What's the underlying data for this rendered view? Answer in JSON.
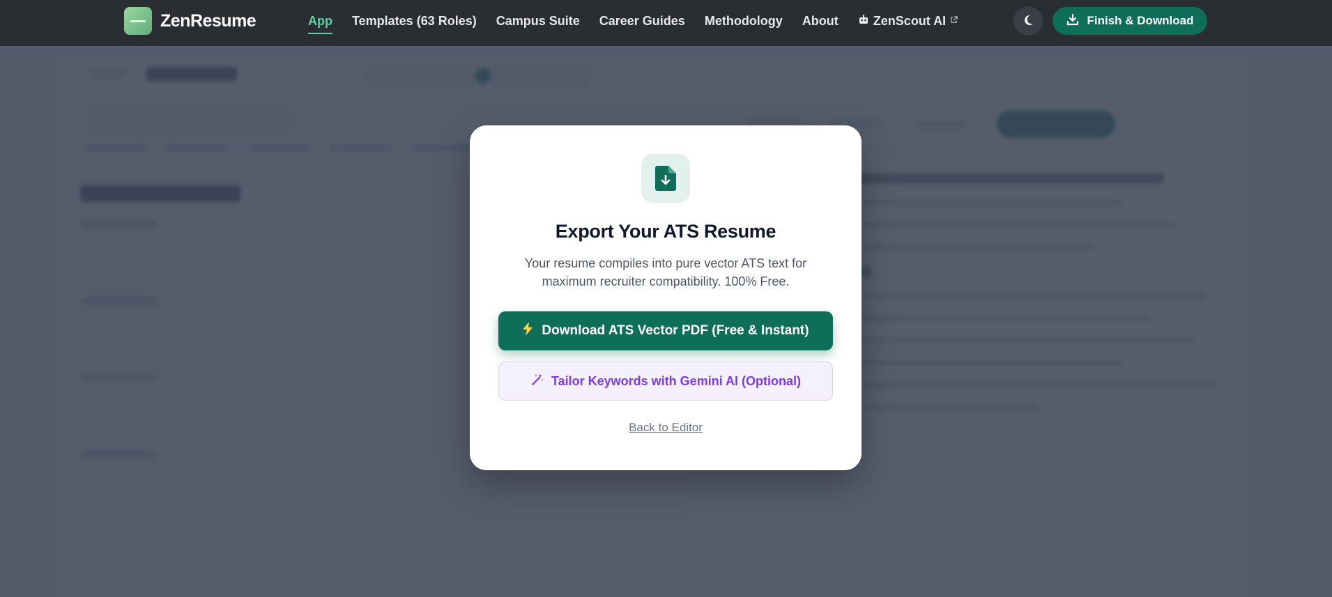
{
  "brand": {
    "name": "ZenResume",
    "logo_icon": "zenresume-logo-icon"
  },
  "nav": {
    "items": [
      {
        "label": "App",
        "active": true
      },
      {
        "label": "Templates (63 Roles)"
      },
      {
        "label": "Campus Suite"
      },
      {
        "label": "Career Guides"
      },
      {
        "label": "Methodology"
      },
      {
        "label": "About"
      },
      {
        "label": "ZenScout AI",
        "icon": "robot-icon",
        "external": true
      }
    ],
    "theme_toggle_icon": "moon-icon",
    "finish_button": {
      "label": "Finish & Download",
      "icon": "download-icon"
    }
  },
  "modal": {
    "icon": "file-download-icon",
    "title": "Export Your ATS Resume",
    "description": "Your resume compiles into pure vector ATS text for maximum recruiter compatibility. 100% Free.",
    "primary_button": {
      "label": "Download ATS Vector PDF (Free & Instant)",
      "icon": "lightning-icon"
    },
    "secondary_button": {
      "label": "Tailor Keywords with Gemini AI (Optional)",
      "icon": "magic-wand-icon"
    },
    "back_link": "Back to Editor"
  },
  "colors": {
    "topbar_bg": "#2a2e33",
    "accent_green": "#0f6e5a",
    "active_nav": "#5fd3a4",
    "ai_purple": "#7c3aed",
    "overlay": "#3a4454"
  }
}
